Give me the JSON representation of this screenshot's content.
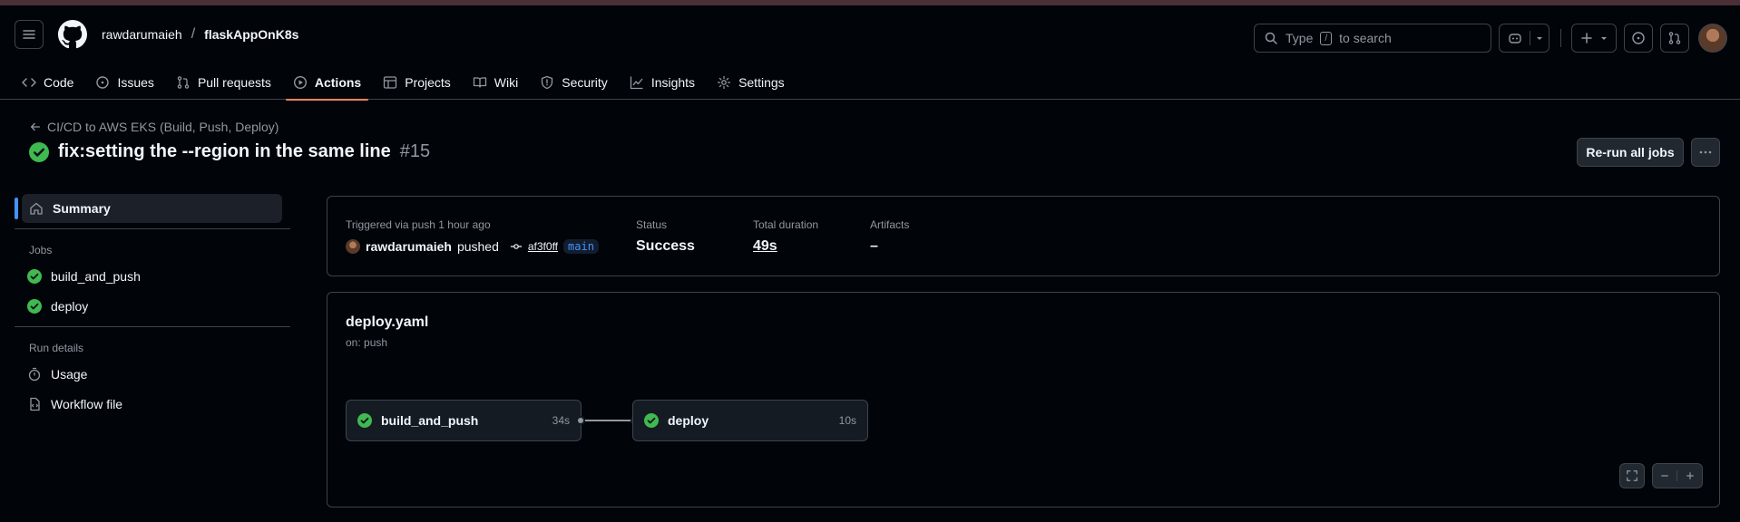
{
  "header": {
    "owner": "rawdarumaieh",
    "separator": "/",
    "repo": "flaskAppOnK8s",
    "search_prefix": "Type",
    "search_key": "/",
    "search_suffix": "to search"
  },
  "nav": {
    "tabs": [
      {
        "label": "Code",
        "icon": "code-icon"
      },
      {
        "label": "Issues",
        "icon": "issue-icon"
      },
      {
        "label": "Pull requests",
        "icon": "pull-request-icon"
      },
      {
        "label": "Actions",
        "icon": "play-icon",
        "active": true
      },
      {
        "label": "Projects",
        "icon": "table-icon"
      },
      {
        "label": "Wiki",
        "icon": "book-icon"
      },
      {
        "label": "Security",
        "icon": "shield-icon"
      },
      {
        "label": "Insights",
        "icon": "graph-icon"
      },
      {
        "label": "Settings",
        "icon": "gear-icon"
      }
    ]
  },
  "run": {
    "workflow_name": "CI/CD to AWS EKS (Build, Push, Deploy)",
    "title": "fix:setting the --region in the same line",
    "number": "#15",
    "rerun_label": "Re-run all jobs"
  },
  "sidebar": {
    "summary_label": "Summary",
    "jobs_heading": "Jobs",
    "jobs": [
      "build_and_push",
      "deploy"
    ],
    "run_details_heading": "Run details",
    "usage_label": "Usage",
    "workflow_file_label": "Workflow file"
  },
  "summary": {
    "triggered": "Triggered via push 1 hour ago",
    "actor": "rawdarumaieh",
    "action": "pushed",
    "commit": "af3f0ff",
    "branch": "main",
    "status_label": "Status",
    "status_value": "Success",
    "duration_label": "Total duration",
    "duration_value": "49s",
    "artifacts_label": "Artifacts",
    "artifacts_value": "–"
  },
  "graph": {
    "file": "deploy.yaml",
    "trigger": "on: push",
    "jobs": [
      {
        "name": "build_and_push",
        "time": "34s"
      },
      {
        "name": "deploy",
        "time": "10s"
      }
    ]
  },
  "colors": {
    "success": "#3fb950",
    "accent": "#4493f8",
    "active_tab": "#f78166"
  }
}
